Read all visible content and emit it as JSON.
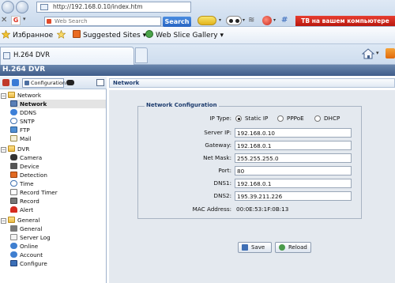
{
  "browser": {
    "address": "http://192.168.0.10/index.htm",
    "search_placeholder": "Web Search",
    "search_button": "Search",
    "promo": "ТВ на вашем компьютере",
    "close_glyph": "✕"
  },
  "favorites_bar": {
    "favorites_label": "Избранное",
    "suggested_sites": "Suggested Sites",
    "web_slice_gallery": "Web Slice Gallery"
  },
  "tab": {
    "title": "H.264 DVR"
  },
  "app": {
    "title": "H.264 DVR",
    "config_button": "Configuration"
  },
  "tree": {
    "network_group": "Network",
    "network": "Network",
    "ddns": "DDNS",
    "sntp": "SNTP",
    "ftp": "FTP",
    "mail": "Mail",
    "dvr_group": "DVR",
    "camera": "Camera",
    "device": "Device",
    "detection": "Detection",
    "time": "Time",
    "record_timer": "Record Timer",
    "record": "Record",
    "alert": "Alert",
    "general_group": "General",
    "general": "General",
    "server_log": "Server Log",
    "online": "Online",
    "account": "Account",
    "configure": "Configure"
  },
  "content": {
    "header": "Network",
    "group_title": "Network Configuration",
    "ip_type_label": "IP Type:",
    "ip_type_options": [
      "Static IP",
      "PPPoE",
      "DHCP"
    ],
    "ip_type_selected": "Static IP",
    "server_ip_label": "Server IP:",
    "server_ip": "192.168.0.10",
    "gateway_label": "Gateway:",
    "gateway": "192.168.0.1",
    "netmask_label": "Net Mask:",
    "netmask": "255.255.255.0",
    "port_label": "Port:",
    "port": "80",
    "dns1_label": "DNS1:",
    "dns1": "192.168.0.1",
    "dns2_label": "DNS2:",
    "dns2": "195.39.211.226",
    "mac_label": "MAC Address:",
    "mac": "00:0E:53:1F:0B:13",
    "save_button": "Save",
    "reload_button": "Reload"
  }
}
